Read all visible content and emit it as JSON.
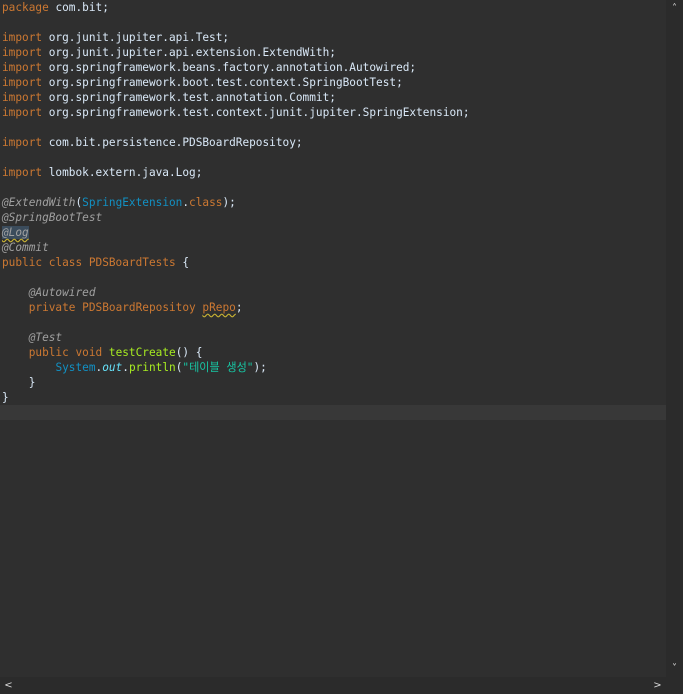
{
  "code": {
    "l01": {
      "kw": "package",
      "rest": " com.bit;"
    },
    "l03": {
      "kw": "import",
      "rest": " org.junit.jupiter.api.Test;"
    },
    "l04": {
      "kw": "import",
      "rest": " org.junit.jupiter.api.extension.ExtendWith;"
    },
    "l05": {
      "kw": "import",
      "rest": " org.springframework.beans.factory.annotation.Autowired;"
    },
    "l06": {
      "kw": "import",
      "rest": " org.springframework.boot.test.context.SpringBootTest;"
    },
    "l07": {
      "kw": "import",
      "rest": " org.springframework.test.annotation.Commit;"
    },
    "l08": {
      "kw": "import",
      "rest": " org.springframework.test.context.junit.jupiter.SpringExtension;"
    },
    "l10": {
      "kw": "import",
      "rest": " com.bit.persistence.PDSBoardRepositoy;"
    },
    "l12": {
      "kw": "import",
      "rest": " lombok.extern.java.Log;"
    },
    "l14": {
      "ann": "@ExtendWith",
      "p1": "(",
      "type": "SpringExtension",
      "dot": ".",
      "kw": "class",
      "p2": ");"
    },
    "l15": {
      "ann": "@SpringBootTest"
    },
    "l16": {
      "ann": "@Log"
    },
    "l17": {
      "ann": "@Commit"
    },
    "l18": {
      "kw": "public class",
      "sp": " ",
      "cls": "PDSBoardTests",
      "rest": " {"
    },
    "l20": {
      "indent": "    ",
      "ann": "@Autowired"
    },
    "l21": {
      "indent": "    ",
      "kw": "private",
      "sp": " ",
      "cls": "PDSBoardRepositoy",
      "sp2": " ",
      "var": "pRepo",
      "rest": ";"
    },
    "l23": {
      "indent": "    ",
      "ann": "@Test"
    },
    "l24": {
      "indent": "    ",
      "kw": "public void",
      "sp": " ",
      "method": "testCreate",
      "rest": "() {"
    },
    "l25": {
      "indent": "        ",
      "type": "System",
      "dot": ".",
      "field": "out",
      "dot2": ".",
      "method": "println",
      "p1": "(",
      "str": "\"테이블 생성\"",
      "p2": ");"
    },
    "l26": {
      "text": "    }"
    },
    "l27": {
      "text": "}"
    }
  },
  "scrollbars": {
    "up": "˄",
    "down": "˅",
    "left": "<",
    "right": ">"
  }
}
